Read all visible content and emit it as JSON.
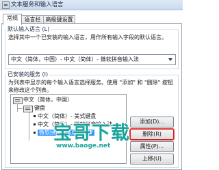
{
  "window": {
    "title": "文本服务和输入语言",
    "icon": "keyboard-window-icon"
  },
  "tabs": [
    {
      "label": "常规",
      "active": true
    },
    {
      "label": "语言栏",
      "active": false
    },
    {
      "label": "高级键设置",
      "active": false
    }
  ],
  "default_language": {
    "title": "默认输入语言 (L)",
    "description": "选择其中一个已安装的输入语言，用作所有输入字段的默认语言。",
    "selected": "中文（简体，中国）- 中文（简体）- 微软拼音输入法"
  },
  "installed_services": {
    "title": "已安装的服务 (I)",
    "description": "为列表中显示的每个输入语言选择服务。使用 \"添加\" 和 \"删除\" 按钮来修改这个列表。",
    "tree": {
      "language": "中文（简体，中国）",
      "category": "键盘",
      "items": [
        {
          "label": "中文（简体）- 美式键盘",
          "selected": false
        },
        {
          "label": "中文（简体）- 微软拼音输入法",
          "selected": false
        },
        {
          "label": "微软拼音输入法 2007",
          "selected": true
        }
      ]
    }
  },
  "buttons": {
    "add": "添加(D)...",
    "delete": "删除(R)",
    "properties": "属性(P)...",
    "move_up": "上移(U)",
    "move_down": "下移(W)"
  },
  "colors": {
    "selection": "#3399ff",
    "delete_highlight": "#d21f1f",
    "watermark": "#1aa39a"
  },
  "watermark": {
    "logo_text": "宝哥下载",
    "url": "www.baoge.net"
  }
}
